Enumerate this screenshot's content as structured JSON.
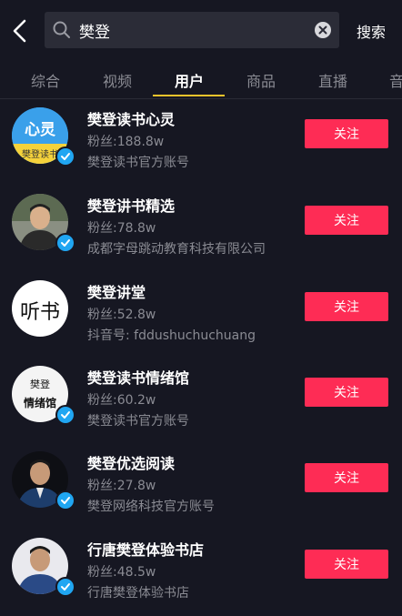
{
  "search": {
    "query": "樊登",
    "button_label": "搜索"
  },
  "tabs": [
    {
      "label": "综合"
    },
    {
      "label": "视频"
    },
    {
      "label": "用户"
    },
    {
      "label": "商品"
    },
    {
      "label": "直播"
    },
    {
      "label": "音"
    }
  ],
  "active_tab": "用户",
  "users": [
    {
      "name": "樊登读书心灵",
      "fans": "粉丝:188.8w",
      "desc": "樊登读书官方账号",
      "follow_label": "关注",
      "avatar_text": "心灵",
      "avatar_subtext": "樊登读书"
    },
    {
      "name": "樊登讲书精选",
      "fans": "粉丝:78.8w",
      "desc": "成都字母跳动教育科技有限公司",
      "follow_label": "关注"
    },
    {
      "name": "樊登讲堂",
      "fans": "粉丝:52.8w",
      "desc": "抖音号: fddushuchuchuang",
      "follow_label": "关注",
      "avatar_text": "听书"
    },
    {
      "name": "樊登读书情绪馆",
      "fans": "粉丝:60.2w",
      "desc": "樊登读书官方账号",
      "follow_label": "关注",
      "avatar_text": "情绪馆",
      "avatar_subtext": "樊登"
    },
    {
      "name": "樊登优选阅读",
      "fans": "粉丝:27.8w",
      "desc": "樊登网络科技官方账号",
      "follow_label": "关注"
    },
    {
      "name": "行唐樊登体验书店",
      "fans": "粉丝:48.5w",
      "desc": "行唐樊登体验书店",
      "follow_label": "关注"
    }
  ],
  "colors": {
    "background": "#161722",
    "follow": "#fe2c55",
    "indicator": "#f5c42c",
    "verified": "#20a6f2"
  }
}
